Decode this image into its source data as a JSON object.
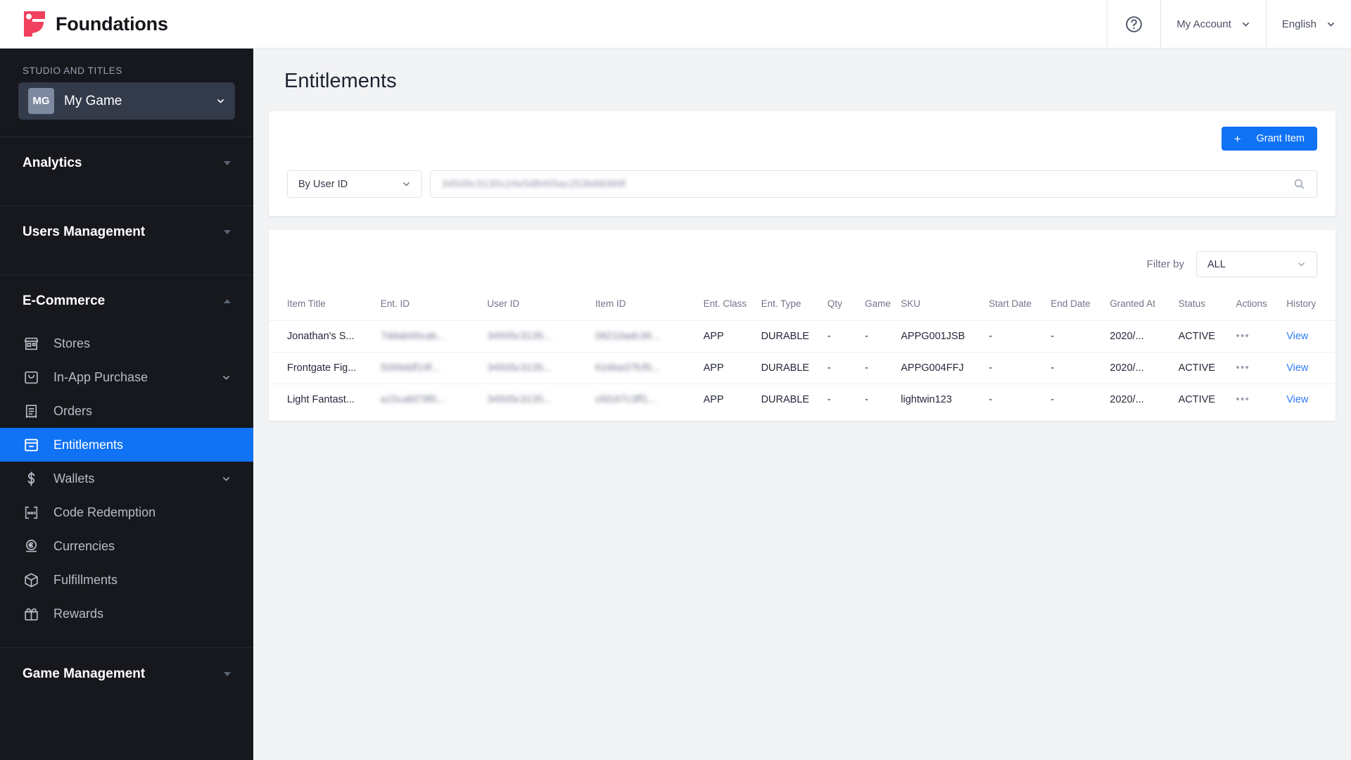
{
  "brand": {
    "name": "Foundations",
    "logo_color": "#f0405e"
  },
  "topbar": {
    "help_icon": "help-circle-icon",
    "account_label": "My Account",
    "language_label": "English"
  },
  "sidebar": {
    "studio_label": "STUDIO AND TITLES",
    "game": {
      "initials": "MG",
      "name": "My Game"
    },
    "sections": [
      {
        "label": "Analytics",
        "expanded": false
      },
      {
        "label": "Users Management",
        "expanded": false
      },
      {
        "label": "E-Commerce",
        "expanded": true
      },
      {
        "label": "Game Management",
        "expanded": false
      }
    ],
    "ecommerce_items": [
      {
        "label": "Stores",
        "icon": "store-icon",
        "active": false,
        "has_chevron": false
      },
      {
        "label": "In-App Purchase",
        "icon": "bag-icon",
        "active": false,
        "has_chevron": true
      },
      {
        "label": "Orders",
        "icon": "receipt-icon",
        "active": false,
        "has_chevron": false
      },
      {
        "label": "Entitlements",
        "icon": "archive-icon",
        "active": true,
        "has_chevron": false
      },
      {
        "label": "Wallets",
        "icon": "dollar-icon",
        "active": false,
        "has_chevron": true
      },
      {
        "label": "Code Redemption",
        "icon": "code-bracket-icon",
        "active": false,
        "has_chevron": false
      },
      {
        "label": "Currencies",
        "icon": "coin-icon",
        "active": false,
        "has_chevron": false
      },
      {
        "label": "Fulfillments",
        "icon": "box-icon",
        "active": false,
        "has_chevron": false
      },
      {
        "label": "Rewards",
        "icon": "gift-icon",
        "active": false,
        "has_chevron": false
      }
    ],
    "active_color": "#1072f5"
  },
  "page": {
    "title": "Entitlements"
  },
  "search_card": {
    "grant_button": {
      "label": "Grant Item",
      "plus": "+"
    },
    "search_by": {
      "value": "By User ID"
    },
    "search_input": {
      "value": "34505c3135c24e5d8455ac253b68389f",
      "placeholder": ""
    },
    "search_icon": "search-icon"
  },
  "table_card": {
    "filter_label": "Filter by",
    "filter_value": "ALL",
    "columns": [
      "Item Title",
      "Ent. ID",
      "User ID",
      "Item ID",
      "Ent. Class",
      "Ent. Type",
      "Qty",
      "Game",
      "SKU",
      "Start Date",
      "End Date",
      "Granted At",
      "Status",
      "Actions",
      "History"
    ],
    "rows": [
      {
        "item_title": "Jonathan's S...",
        "ent_id": "7ddab00cab...",
        "user_id": "34505c3135...",
        "item_id": "08210adc39...",
        "ent_class": "APP",
        "ent_type": "DURABLE",
        "qty": "-",
        "game": "-",
        "sku": "APPG001JSB",
        "start_date": "-",
        "end_date": "-",
        "granted_at": "2020/...",
        "status": "ACTIVE",
        "actions": "•••",
        "history": "View"
      },
      {
        "item_title": "Frontgate Fig...",
        "ent_id": "5099ddf19f...",
        "user_id": "34505c3135...",
        "item_id": "616ba37fcf0...",
        "ent_class": "APP",
        "ent_type": "DURABLE",
        "qty": "-",
        "game": "-",
        "sku": "APPG004FFJ",
        "start_date": "-",
        "end_date": "-",
        "granted_at": "2020/...",
        "status": "ACTIVE",
        "actions": "•••",
        "history": "View"
      },
      {
        "item_title": "Light Fantast...",
        "ent_id": "a15cafd79f0...",
        "user_id": "34505c3135...",
        "item_id": "cfd167c3ff1...",
        "ent_class": "APP",
        "ent_type": "DURABLE",
        "qty": "-",
        "game": "-",
        "sku": "lightwin123",
        "start_date": "-",
        "end_date": "-",
        "granted_at": "2020/...",
        "status": "ACTIVE",
        "actions": "•••",
        "history": "View"
      }
    ]
  }
}
